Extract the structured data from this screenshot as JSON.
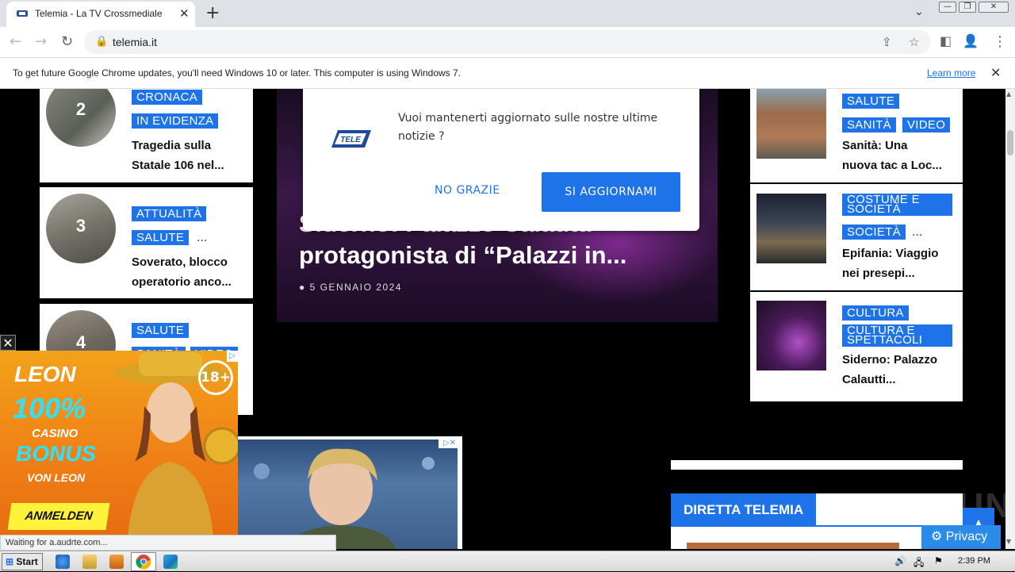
{
  "browser": {
    "tab_title": "Telemia - La TV Crossmediale",
    "tab_close": "✕",
    "new_tab": "+",
    "tab_search": "⌄",
    "url": "telemia.it",
    "back": "←",
    "forward": "→",
    "reload": "↻",
    "lock": "🔒",
    "share": "⇪",
    "bookmark": "☆",
    "sidepanel": "◧",
    "profile": "👤",
    "menu": "⋮",
    "win_min": "—",
    "win_max": "❐",
    "win_close": "✕",
    "infobar_message": "To get future Google Chrome updates, you'll need Windows 10 or later. This computer is using Windows 7.",
    "infobar_link": "Learn more",
    "infobar_close": "✕",
    "status_text": "Waiting for a.audrte.com..."
  },
  "left_list": [
    {
      "rank": "2",
      "tags": [
        "CRONACA",
        "IN EVIDENZA"
      ],
      "more": "",
      "headline": [
        "Tragedia sulla",
        "Statale 106 nel..."
      ]
    },
    {
      "rank": "3",
      "tags": [
        "ATTUALITÀ",
        "SALUTE"
      ],
      "more": "...",
      "headline": [
        "Soverato, blocco",
        "operatorio anco..."
      ]
    },
    {
      "rank": "4",
      "tags": [
        "SALUTE",
        "SANITÀ",
        "VIDEO"
      ],
      "more": "",
      "headline": [
        "",
        ""
      ]
    }
  ],
  "feature": {
    "title_line1": "Siderno: Palazzo Calautti",
    "title_line2": "protagonista di “Palazzi in...",
    "date": "5 GENNAIO 2024",
    "clock_icon": "●"
  },
  "popup": {
    "logo_text": "TELE",
    "message": "Vuoi mantenerti aggiornato sulle nostre ultime notizie ?",
    "no_label": "NO GRAZIE",
    "yes_label": "SI AGGIORNAMI"
  },
  "right_list": [
    {
      "tags": [
        "SALUTE",
        "SANITÀ",
        "VIDEO"
      ],
      "more": "",
      "headline": [
        "Sanità: Una",
        "nuova tac a Loc..."
      ]
    },
    {
      "tags": [
        "COSTUME E SOCIETÀ",
        "SOCIETÀ"
      ],
      "more": "...",
      "headline": [
        "Epifania: Viaggio",
        "nei presepi..."
      ]
    },
    {
      "tags": [
        "CULTURA",
        "CULTURA E SPETTACOLI"
      ],
      "more": "",
      "headline": [
        "Siderno: Palazzo",
        "Calautti..."
      ]
    }
  ],
  "ads": {
    "close": "✕",
    "leon_brand": "LEON",
    "leon_pct": "100%",
    "leon_casino": "CASINO",
    "leon_bonus": "BONUS",
    "leon_von": "VON LEON",
    "leon_cta": "ANMELDEN",
    "leon_age": "18+",
    "adchoices": "▷",
    "adchoices2": "▷✕"
  },
  "diretta": {
    "label": "DIRETTA TELEMIA"
  },
  "privacy": {
    "label": "⚙ Privacy"
  },
  "scroll_top": "▲",
  "watermark": "ANY▷RUN",
  "taskbar": {
    "start": "Start",
    "clock": "2:39 PM"
  },
  "colors": {
    "accent": "#1e73e8",
    "page_bg": "#000000"
  }
}
